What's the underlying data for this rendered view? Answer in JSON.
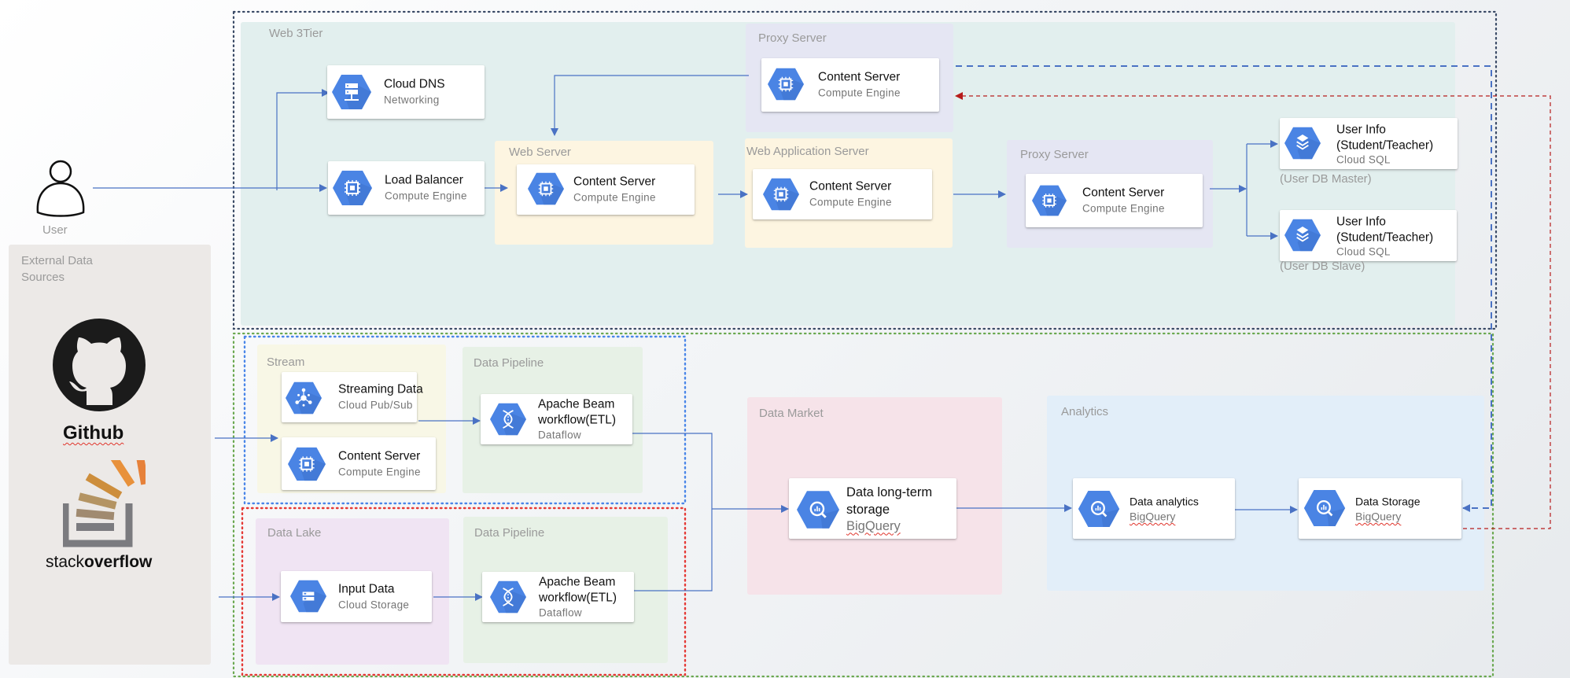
{
  "user": {
    "label": "User"
  },
  "external": {
    "title": "External Data Sources",
    "github_label": "Github",
    "stackoverflow_label_light": "stack",
    "stackoverflow_label_bold": "overflow"
  },
  "web3tier": {
    "title": "Web 3Tier",
    "cloud_dns": {
      "title": "Cloud DNS",
      "sub": "Networking"
    },
    "load_balancer": {
      "title": "Load Balancer",
      "sub": "Compute Engine"
    },
    "web_server": {
      "title": "Web Server",
      "card": {
        "title": "Content Server",
        "sub": "Compute Engine"
      }
    },
    "proxy_top": {
      "title": "Proxy Server",
      "card": {
        "title": "Content Server",
        "sub": "Compute Engine"
      }
    },
    "web_app_server": {
      "title": "Web Application Server",
      "card": {
        "title": "Content Server",
        "sub": "Compute Engine"
      }
    },
    "proxy_right": {
      "title": "Proxy Server",
      "card": {
        "title": "Content Server",
        "sub": "Compute Engine"
      }
    },
    "db_master": {
      "title_line1": "User Info",
      "title_line2": "(Student/Teacher)",
      "sub": "Cloud SQL",
      "note": "(User DB Master)"
    },
    "db_slave": {
      "title_line1": "User Info",
      "title_line2": "(Student/Teacher)",
      "sub": "Cloud SQL",
      "note": "(User DB Slave)"
    }
  },
  "stream": {
    "title": "Stream",
    "pubsub": {
      "title": "Streaming Data",
      "sub": "Cloud Pub/Sub"
    },
    "content": {
      "title": "Content Server",
      "sub": "Compute Engine"
    }
  },
  "pipeline_top": {
    "title": "Data Pipeline",
    "card": {
      "title_line1": "Apache Beam",
      "title_line2": "workflow(ETL)",
      "sub": "Dataflow"
    }
  },
  "datalake": {
    "title": "Data Lake",
    "card": {
      "title": "Input Data",
      "sub": "Cloud Storage"
    }
  },
  "pipeline_bottom": {
    "title": "Data Pipeline",
    "card": {
      "title_line1": "Apache Beam",
      "title_line2": "workflow(ETL)",
      "sub": "Dataflow"
    }
  },
  "datamarket": {
    "title": "Data Market",
    "card": {
      "title_line1": "Data long-term",
      "title_line2": "storage",
      "sub": "BigQuery"
    }
  },
  "analytics": {
    "title": "Analytics",
    "analytics_card": {
      "title": "Data analytics",
      "sub": "BigQuery"
    },
    "storage_card": {
      "title": "Data Storage",
      "sub": "BigQuery"
    }
  },
  "colors": {
    "gcp_blue": "#4a84e4",
    "connector": "#4a72c4",
    "frame_web": "#3a4a66",
    "frame_analytics": "#6aa84f",
    "frame_stream": "#4a86e8",
    "frame_lake": "#e53935",
    "feedback_red": "#b71c1c"
  }
}
